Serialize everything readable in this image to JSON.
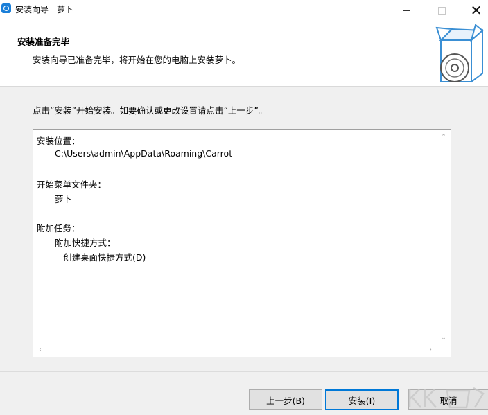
{
  "window": {
    "title": "安装向导 - 萝卜",
    "icons": {
      "app": "setup-app-icon",
      "minimize": "minimize-icon",
      "maximize": "maximize-icon",
      "close": "close-icon"
    },
    "close_glyph": "✕"
  },
  "header": {
    "title": "安装准备完毕",
    "subtitle": "安装向导已准备完毕，将开始在您的电脑上安装萝卜。",
    "graphic": "install-box-disc-icon"
  },
  "instruction": "点击“安装”开始安装。如要确认或更改设置请点击“上一步”。",
  "summary": {
    "lines": [
      "安装位置：",
      "C:\\Users\\admin\\AppData\\Roaming\\Carrot",
      "开始菜单文件夹：",
      "萝卜",
      "附加任务：",
      "附加快捷方式：",
      "创建桌面快捷方式(D)"
    ],
    "scroll_glyphs": {
      "up": "⌃",
      "down": "⌄",
      "left": "‹",
      "right": "›"
    }
  },
  "buttons": {
    "back": "上一步(B)",
    "install": "安装(I)",
    "cancel": "取消"
  },
  "colors": {
    "accent": "#0078d7",
    "app_icon": "#1b7fd8",
    "graphic": "#3a8fd4"
  }
}
